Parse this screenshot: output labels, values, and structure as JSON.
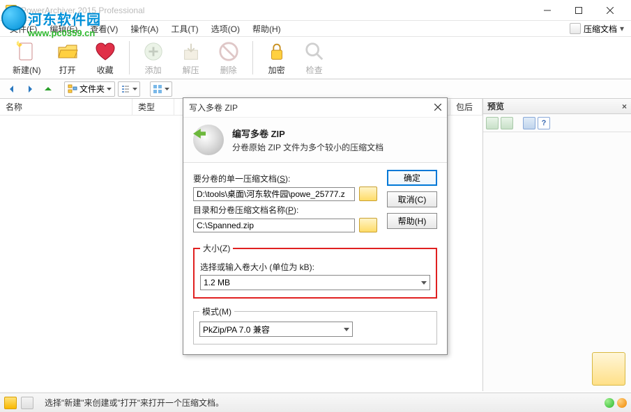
{
  "window": {
    "title": "PowerArchiver 2015 Professional"
  },
  "menu": {
    "file": "文件(F)",
    "edit": "编辑(E)",
    "view": "查看(V)",
    "action": "操作(A)",
    "tool": "工具(T)",
    "option": "选项(O)",
    "help": "帮助(H)",
    "compressed_doc": "压缩文档"
  },
  "watermark": {
    "text": "河东软件园",
    "url": "www.pc0359.cn"
  },
  "toolbar": {
    "new": "新建(N)",
    "open": "打开",
    "favorite": "收藏",
    "add": "添加",
    "extract": "解压",
    "delete": "删除",
    "encrypt": "加密",
    "check": "检查"
  },
  "nav": {
    "folders": "文件夹"
  },
  "columns": {
    "name": "名称",
    "type": "类型",
    "after": "包后"
  },
  "preview": {
    "title": "预览"
  },
  "statusbar": {
    "text": "选择\"新建\"来创建或\"打开\"来打开一个压缩文档。"
  },
  "dialog": {
    "title": "写入多卷 ZIP",
    "header_title": "编写多卷 ZIP",
    "header_sub": "分卷原始 ZIP 文件为多个较小的压缩文档",
    "src_label_pre": "要分卷的单一压缩文档(",
    "src_label_u": "S",
    "src_label_post": "):",
    "src_value": "D:\\tools\\桌面\\河东软件园\\powe_25777.z",
    "dst_label_pre": "目录和分卷压缩文档名称(",
    "dst_label_u": "P",
    "dst_label_post": "):",
    "dst_value": "C:\\Spanned.zip",
    "size_legend_pre": "大小(",
    "size_legend_u": "Z",
    "size_legend_post": ")",
    "size_label": "选择或输入卷大小 (单位为 kB):",
    "size_value": "1.2 MB",
    "mode_legend_pre": "模式(",
    "mode_legend_u": "M",
    "mode_legend_post": ")",
    "mode_value": "PkZip/PA 7.0 兼容",
    "ok": "确定",
    "cancel": "取消(C)",
    "help": "帮助(H)"
  }
}
